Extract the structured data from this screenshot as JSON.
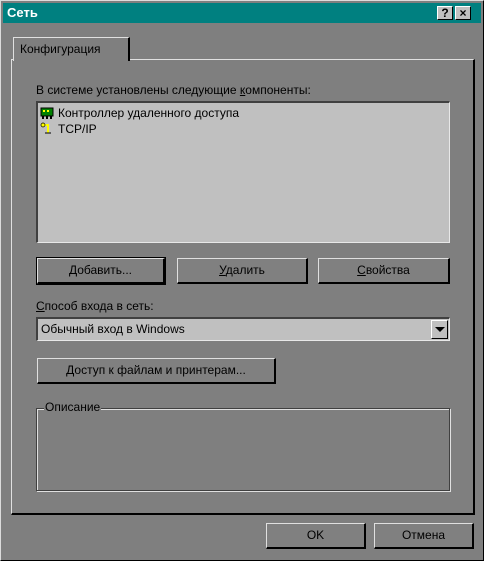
{
  "window": {
    "title": "Сеть"
  },
  "titlebar": {
    "help_label": "?",
    "close_label": "×"
  },
  "tabs": [
    {
      "label": "Конфигурация"
    }
  ],
  "components": {
    "label_before": "В системе установлены следующие ",
    "label_accel": "к",
    "label_after": "омпоненты:",
    "items": [
      {
        "icon": "network-adapter-icon",
        "label": "Контроллер удаленного доступа"
      },
      {
        "icon": "protocol-icon",
        "label": "TCP/IP"
      }
    ]
  },
  "buttons": {
    "add": {
      "accel": "Д",
      "rest": "обавить..."
    },
    "remove": {
      "accel": "У",
      "rest": "далить"
    },
    "properties": {
      "accel": "С",
      "rest": "войства"
    }
  },
  "logon": {
    "label_accel": "С",
    "label_rest": "пособ входа в сеть:",
    "value": "Обычный вход в Windows"
  },
  "sharing_button": {
    "accel": "Д",
    "rest": "оступ к файлам и принтерам..."
  },
  "description": {
    "label": "Описание",
    "text": ""
  },
  "footer": {
    "ok_label": "OK",
    "cancel_label": "Отмена"
  },
  "colors": {
    "titlebar": "#008080",
    "face": "#7f7f7f",
    "list_bg": "#c0c0c0"
  }
}
